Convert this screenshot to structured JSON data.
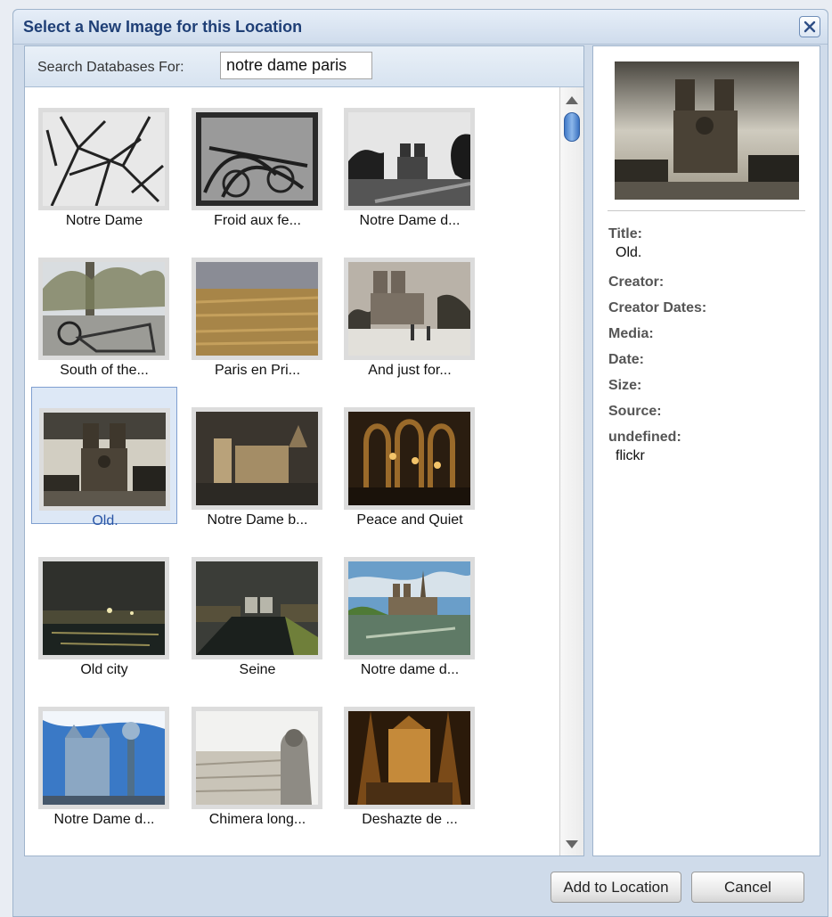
{
  "dialog": {
    "title": "Select a New Image for this Location",
    "search_label": "Search Databases For:",
    "search_value": "notre dame paris"
  },
  "results": [
    {
      "caption": "Notre Dame",
      "selected": false
    },
    {
      "caption": "Froid aux fe...",
      "selected": false
    },
    {
      "caption": "Notre Dame d...",
      "selected": false
    },
    {
      "caption": "South of the...",
      "selected": false
    },
    {
      "caption": "Paris en Pri...",
      "selected": false
    },
    {
      "caption": "And just for...",
      "selected": false
    },
    {
      "caption": "Old.",
      "selected": true
    },
    {
      "caption": "Notre Dame b...",
      "selected": false
    },
    {
      "caption": "Peace and Quiet",
      "selected": false
    },
    {
      "caption": "Old city",
      "selected": false
    },
    {
      "caption": "Seine",
      "selected": false
    },
    {
      "caption": "Notre dame d...",
      "selected": false
    },
    {
      "caption": "Notre Dame d...",
      "selected": false
    },
    {
      "caption": "Chimera long...",
      "selected": false
    },
    {
      "caption": "Deshazte de ...",
      "selected": false
    }
  ],
  "details": {
    "title_label": "Title:",
    "title_value": "Old.",
    "creator_label": "Creator:",
    "creator_dates_label": "Creator Dates:",
    "media_label": "Media:",
    "date_label": "Date:",
    "size_label": "Size:",
    "source_label": "Source:",
    "undefined_label": "undefined:",
    "undefined_value": "flickr"
  },
  "buttons": {
    "add": "Add to Location",
    "cancel": "Cancel"
  },
  "icons": {
    "close": "close-icon",
    "scroll_up": "scroll-up-arrow-icon",
    "scroll_down": "scroll-down-arrow-icon"
  },
  "colors": {
    "title_text": "#1f3f76",
    "selection_bg": "#dde8f6",
    "selection_border": "#7f9fd0",
    "selected_caption": "#2a56a6"
  }
}
